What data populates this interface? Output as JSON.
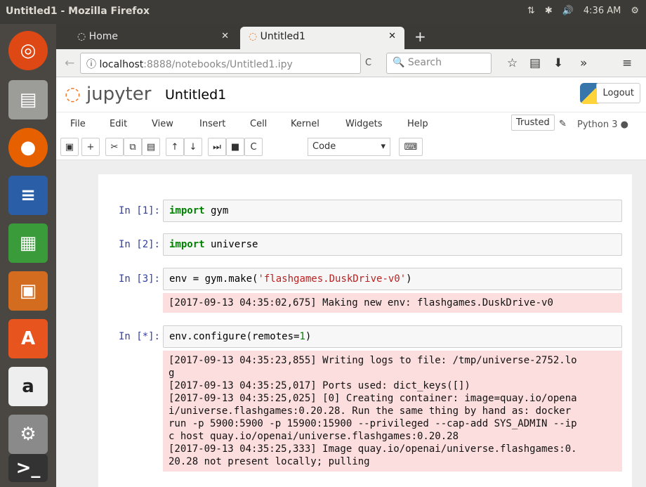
{
  "window": {
    "title": "Untitled1 - Mozilla Firefox",
    "clock": "4:36 AM"
  },
  "tabs": [
    {
      "label": "Home"
    },
    {
      "label": "Untitled1"
    }
  ],
  "navbar": {
    "url_host": "localhost",
    "url_path": ":8888/notebooks/Untitled1.ipy",
    "search_placeholder": "Search"
  },
  "jupyter": {
    "logo_text": "jupyter",
    "notebook_name": "Untitled1",
    "logout_label": "Logout",
    "menu": [
      "File",
      "Edit",
      "View",
      "Insert",
      "Cell",
      "Kernel",
      "Widgets",
      "Help"
    ],
    "trusted_label": "Trusted",
    "kernel_label": "Python 3",
    "cell_type": "Code"
  },
  "cells": [
    {
      "prompt": "In [1]:",
      "code_kw": "import",
      "code_rest": " gym"
    },
    {
      "prompt": "In [2]:",
      "code_kw": "import",
      "code_rest": " universe"
    },
    {
      "prompt": "In [3]:",
      "code_pre": "env = gym.make(",
      "code_str": "'flashgames.DuskDrive-v0'",
      "code_post": ")",
      "output": "[2017-09-13 04:35:02,675] Making new env: flashgames.DuskDrive-v0"
    },
    {
      "prompt": "In [*]:",
      "code_pre": "env.configure(remotes=",
      "code_num": "1",
      "code_post": ")",
      "output": "[2017-09-13 04:35:23,855] Writing logs to file: /tmp/universe-2752.lo\ng\n[2017-09-13 04:35:25,017] Ports used: dict_keys([])\n[2017-09-13 04:35:25,025] [0] Creating container: image=quay.io/opena\ni/universe.flashgames:0.20.28. Run the same thing by hand as: docker\nrun -p 5900:5900 -p 15900:15900 --privileged --cap-add SYS_ADMIN --ip\nc host quay.io/openai/universe.flashgames:0.20.28\n[2017-09-13 04:35:25,333] Image quay.io/openai/universe.flashgames:0.\n20.28 not present locally; pulling"
    }
  ]
}
